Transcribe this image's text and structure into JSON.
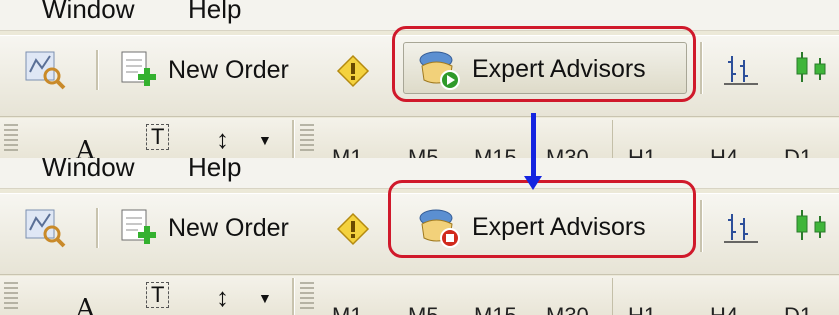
{
  "menu": {
    "window": "Window",
    "help": "Help"
  },
  "toolbar": {
    "new_order_label": "New Order",
    "expert_advisors_label": "Expert Advisors"
  },
  "states": [
    {
      "id": "before",
      "expert_advisors_status": "enabled",
      "status_color": "#2f9a2a",
      "button_pressed": true
    },
    {
      "id": "after",
      "expert_advisors_status": "disabled",
      "status_color": "#d12a1c",
      "button_pressed": false
    }
  ],
  "timeframes": [
    "M1",
    "M5",
    "M15",
    "M30",
    "H1",
    "H4",
    "D1"
  ],
  "highlight_color": "#d0192b",
  "arrow_color": "#1424e0"
}
